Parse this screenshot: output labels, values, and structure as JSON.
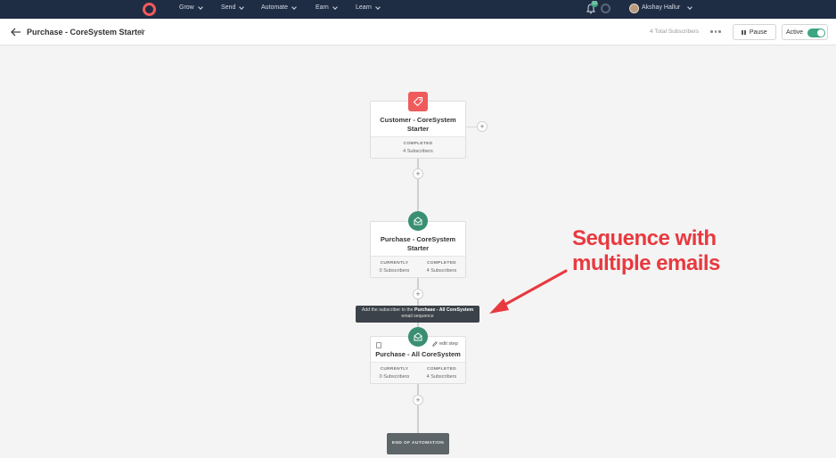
{
  "nav": {
    "items": [
      "Grow",
      "Send",
      "Automate",
      "Earn",
      "Learn"
    ],
    "notification_count": "10",
    "user_name": "Akshay Hallur"
  },
  "header": {
    "title": "Purchase - CoreSystem Starter",
    "total_subscribers": "4 Total Subscribers",
    "pause_label": "Pause",
    "active_label": "Active",
    "active": true
  },
  "flow": {
    "trigger": {
      "title": "Customer - CoreSystem Starter",
      "status_label": "COMPLETED",
      "status_value": "4 Subscribers"
    },
    "step1": {
      "title": "Purchase - CoreSystem Starter",
      "currently_label": "CURRENTLY",
      "currently_value": "0 Subscribers",
      "completed_label": "COMPLETED",
      "completed_value": "4 Subscribers"
    },
    "tooltip": {
      "prefix": "Add the subscriber to the ",
      "sequence": "Purchase - All CoreSystem",
      "suffix": " email sequence"
    },
    "step2": {
      "title": "Purchase - All CoreSystem",
      "edit_label": "edit step",
      "currently_label": "CURRENTLY",
      "currently_value": "0 Subscribers",
      "completed_label": "COMPLETED",
      "completed_value": "4 Subscribers"
    },
    "end_label": "END OF AUTOMATION"
  },
  "annotation": {
    "line1": "Sequence with",
    "line2": "multiple emails"
  },
  "colors": {
    "nav_bg": "#1f2d44",
    "brand": "#ef5b5b",
    "green": "#3a8f72",
    "annotation": "#e8393f"
  }
}
